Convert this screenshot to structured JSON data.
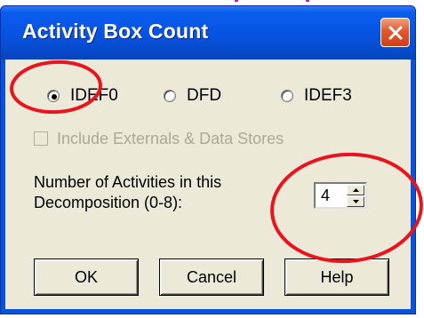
{
  "dialog": {
    "title": "Activity Box Count",
    "close_icon": "close-icon"
  },
  "methods": {
    "options": [
      {
        "label": "IDEF0",
        "selected": true
      },
      {
        "label": "DFD",
        "selected": false
      },
      {
        "label": "IDEF3",
        "selected": false
      }
    ]
  },
  "include_externals": {
    "label": "Include Externals & Data Stores",
    "checked": false,
    "enabled": false
  },
  "activity_count": {
    "label_line1": "Number of Activities in this",
    "label_line2": "Decomposition (0-8):",
    "value": "4"
  },
  "buttons": {
    "ok": "OK",
    "cancel": "Cancel",
    "help": "Help"
  },
  "colors": {
    "title_bar": "#0a52d8",
    "dialog_face": "#ece9d8",
    "close_button": "#e2572c",
    "annotation": "#e8141e"
  }
}
